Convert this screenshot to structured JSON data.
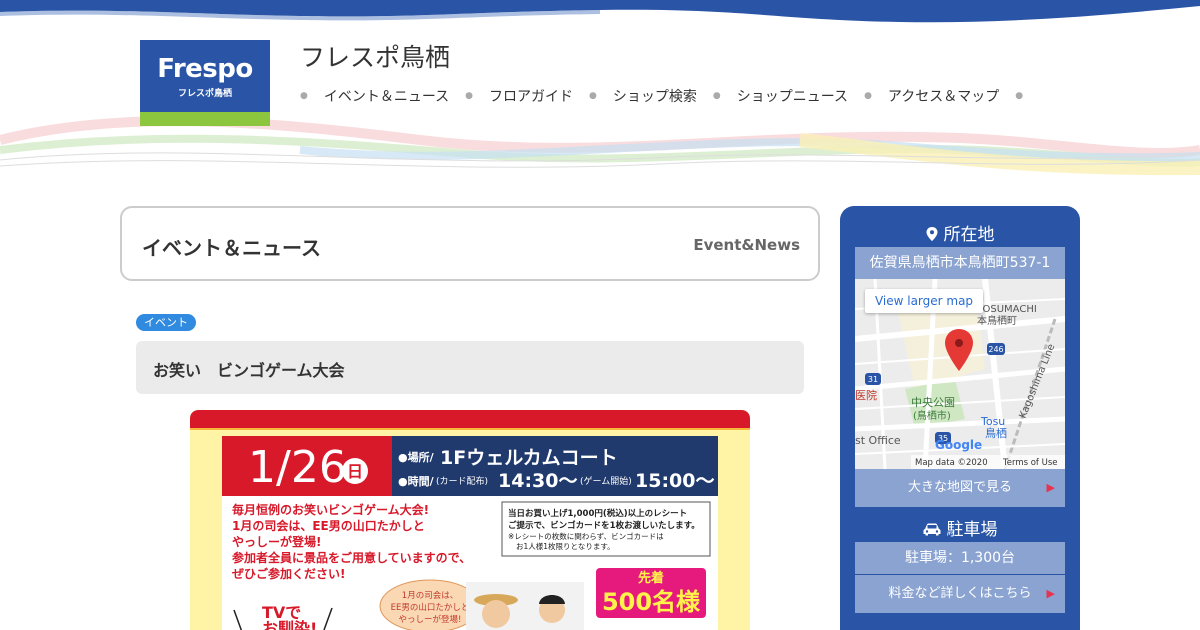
{
  "site": {
    "logo_text": "Frespo",
    "logo_sub": "フレスポ鳥栖",
    "title": "フレスポ鳥栖"
  },
  "nav": {
    "items": [
      {
        "label": "イベント＆ニュース"
      },
      {
        "label": "フロアガイド"
      },
      {
        "label": "ショップ検索"
      },
      {
        "label": "ショップニュース"
      },
      {
        "label": "アクセス＆マップ"
      }
    ]
  },
  "section": {
    "title": "イベント＆ニュース",
    "title_en": "Event&News"
  },
  "article": {
    "tag": "イベント",
    "title": "お笑い　ビンゴゲーム大会"
  },
  "poster": {
    "date": "1/26",
    "day": "日",
    "place_label": "●場所/",
    "place": "1Fウェルカムコート",
    "time_label": "●時間/",
    "card_label": "(カード配布)",
    "card_time": "14:30〜",
    "game_label": "(ゲーム開始)",
    "game_time": "15:00〜",
    "body_lines": [
      "毎月恒例のお笑いビンゴゲーム大会!",
      "1月の司会は、EE男の山口たかしと",
      "やっしーが登場!",
      "参加者全員に景品をご用意していますので、",
      "ぜひご参加ください!"
    ],
    "note_lines": [
      "当日お買い上げ1,000円(税込)以上のレシート",
      "ご提示で、ビンゴカードを1枚お渡しいたします。",
      "※レシートの枚数に関わらず、ビンゴカードは",
      "お1人様1枚限りとなります。"
    ],
    "first_label": "先着",
    "first_count": "500名様",
    "tv_text": "TVで",
    "tv_text2": "お馴染!",
    "bubble_lines": [
      "1月の司会は、",
      "EE男の山口たかしと",
      "やっしーが登場!"
    ],
    "colors": {
      "red": "#d7192a",
      "navy": "#203a6e",
      "yellow": "#fff3a6",
      "pink": "#e6197d"
    }
  },
  "sidebar": {
    "location_heading": "所在地",
    "address": "佐賀県鳥栖市本鳥栖町537-1",
    "map": {
      "button": "View larger map",
      "labels": {
        "district": "HOSUMACHI",
        "district_jp": "本鳥栖町",
        "park": "中央公園",
        "park_sub": "(鳥栖市)",
        "station": "Tosu",
        "station_jp": "鳥栖",
        "line": "Kagoshima Line",
        "office": "st Office",
        "hospital": "医院",
        "route1": "246",
        "route2": "31",
        "route3": "35",
        "copyright": "Map data ©2020",
        "terms": "Terms of Use",
        "google": "Google"
      }
    },
    "big_map_label": "大きな地図で見る",
    "parking_heading": "駐車場",
    "parking_count": "駐車場：1,300台",
    "parking_link": "料金など詳しくはこちら"
  },
  "colors": {
    "brand": "#2a55a6",
    "light_brand": "#8aa3d0",
    "tag": "#2f8ae0",
    "accent": "#e8324f"
  }
}
